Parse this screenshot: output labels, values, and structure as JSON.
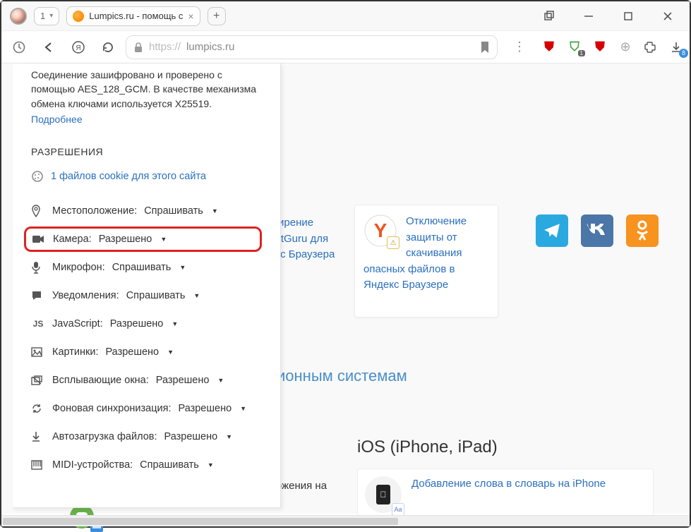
{
  "window": {
    "tab_count": "1",
    "tab_title": "Lumpics.ru - помощь с",
    "url_protocol": "https://",
    "url_host": "lumpics.ru",
    "downloads_badge": "8",
    "ext_badge": "1"
  },
  "popover": {
    "intro": "Соединение зашифровано и проверено с помощью AES_128_GCM. В качестве механизма обмена ключами используется X25519.",
    "more": "Подробнее",
    "section": "РАЗРЕШЕНИЯ",
    "cookies": "1 файлов cookie для этого сайта",
    "perms": [
      {
        "icon": "📍",
        "label": "Местоположение:",
        "value": "Спрашивать"
      },
      {
        "icon": "📷",
        "label": "Камера:",
        "value": "Разрешено"
      },
      {
        "icon": "🎤",
        "label": "Микрофон:",
        "value": "Спрашивать"
      },
      {
        "icon": "💬",
        "label": "Уведомления:",
        "value": "Спрашивать"
      },
      {
        "icon": "JS",
        "label": "JavaScript:",
        "value": "Разрешено"
      },
      {
        "icon": "🖼",
        "label": "Картинки:",
        "value": "Разрешено"
      },
      {
        "icon": "⬜",
        "label": "Всплывающие окна:",
        "value": "Разрешено"
      },
      {
        "icon": "↻",
        "label": "Фоновая синхронизация:",
        "value": "Разрешено"
      },
      {
        "icon": "⬇",
        "label": "Автозагрузка файлов:",
        "value": "Разрешено"
      },
      {
        "icon": "🎹",
        "label": "MIDI-устройства:",
        "value": "Спрашивать"
      }
    ]
  },
  "page": {
    "card_left_l1": "ширение",
    "card_left_l2": "ketGuru для",
    "card_left_l3": "екс Браузера",
    "card1_link": "Отключение защиты от скачивания опасных файлов в Яндекс Браузере",
    "section_head": "ионным системам",
    "ios_head": "iOS (iPhone, iPad)",
    "ios_link": "Добавление слова в словарь на iPhone",
    "left_frag": "ложения на"
  }
}
